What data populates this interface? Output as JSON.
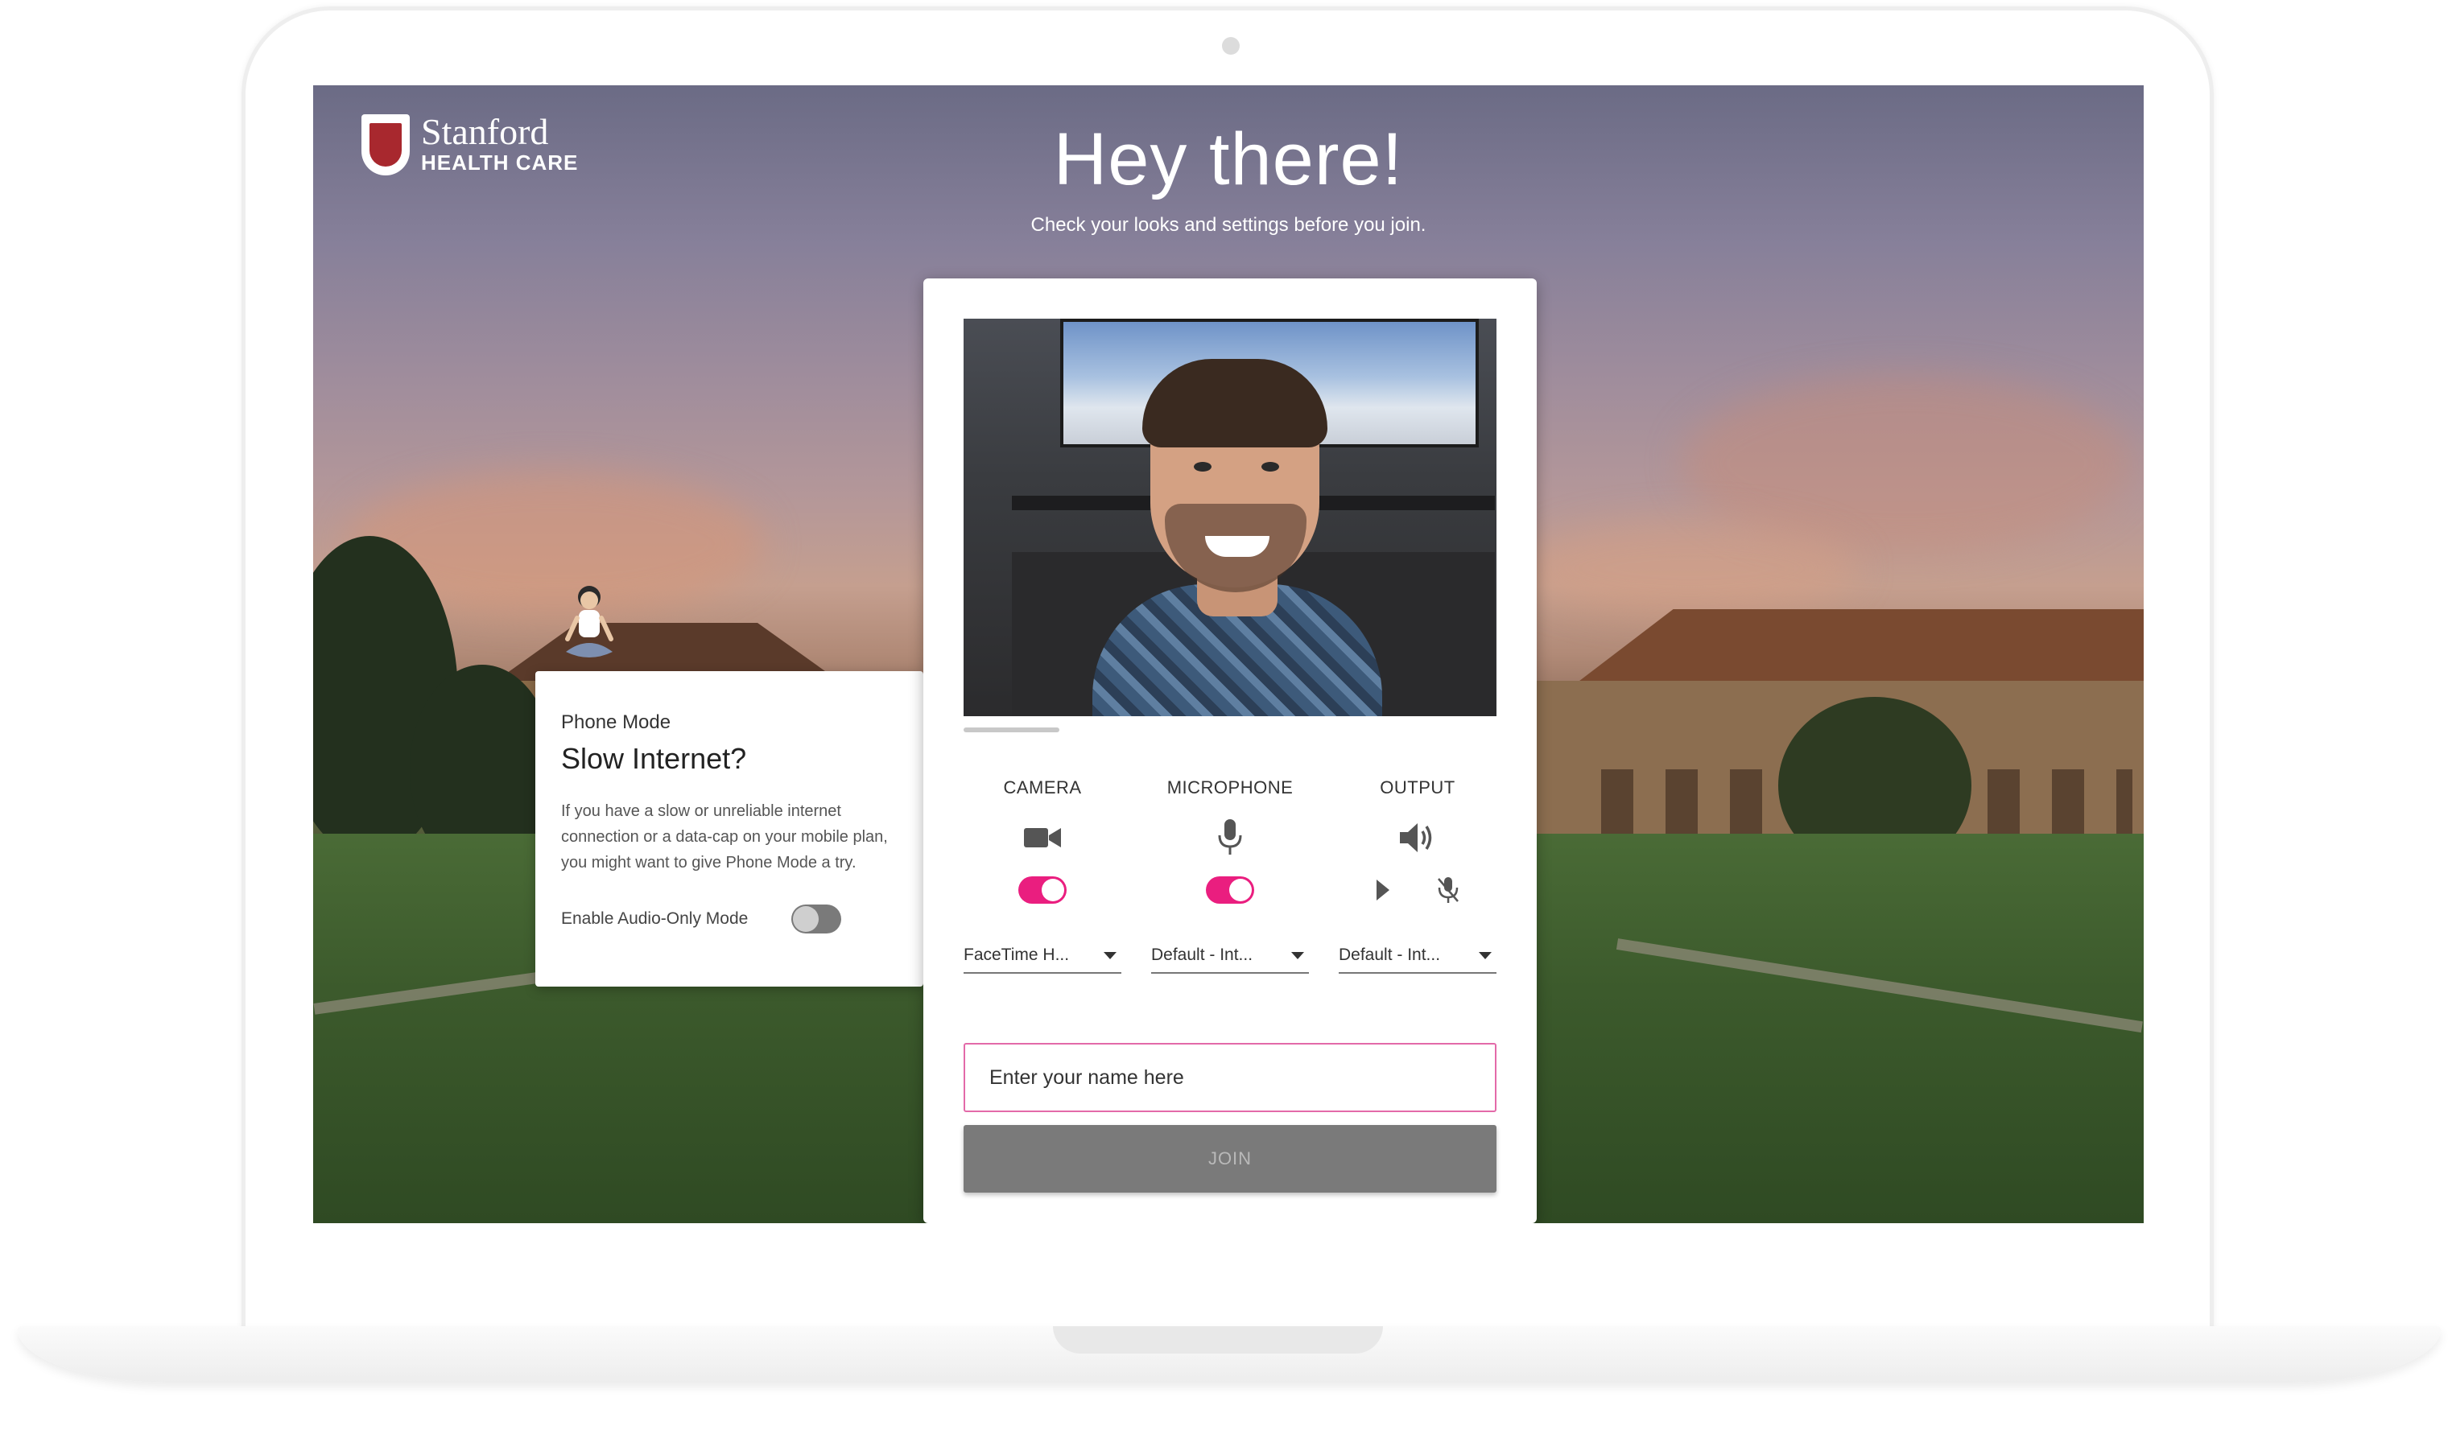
{
  "brand": {
    "name": "Stanford",
    "subtitle": "HEALTH CARE"
  },
  "header": {
    "title": "Hey there!",
    "subtitle": "Check your looks and settings before you join."
  },
  "phone_mode": {
    "label": "Phone Mode",
    "title": "Slow Internet?",
    "description": "If you have a slow or unreliable internet connection or a data-cap on your mobile plan, you might want to give Phone Mode a try.",
    "toggle_label": "Enable Audio-Only Mode",
    "toggle_on": false
  },
  "preview": {
    "progress": 0.18
  },
  "devices": {
    "camera": {
      "label": "CAMERA",
      "icon": "video-camera-icon",
      "enabled": true,
      "selected": "FaceTime H..."
    },
    "microphone": {
      "label": "MICROPHONE",
      "icon": "microphone-icon",
      "enabled": true,
      "selected": "Default - Int..."
    },
    "output": {
      "label": "OUTPUT",
      "icon": "speaker-icon",
      "selected": "Default - Int..."
    }
  },
  "name_input": {
    "placeholder": "Enter your name here",
    "value": ""
  },
  "join_button": {
    "label": "JOIN"
  },
  "colors": {
    "accent": "#ea1e7f",
    "input_border": "#e36aa9",
    "button_disabled": "#7a7a7a",
    "brand_red": "#a8282e"
  }
}
